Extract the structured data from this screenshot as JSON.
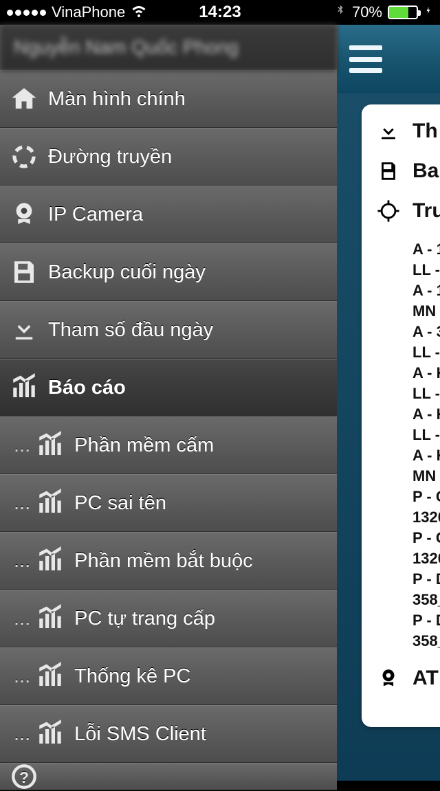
{
  "status": {
    "carrier": "VinaPhone",
    "time": "14:23",
    "battery_pct": "70%"
  },
  "drawer": {
    "header_name": "Nguyễn Nam Quốc Phong",
    "items": [
      {
        "id": "home",
        "label": "Màn hình chính",
        "icon": "home-icon"
      },
      {
        "id": "line",
        "label": "Đường truyền",
        "icon": "target-icon"
      },
      {
        "id": "ipcam",
        "label": "IP Camera",
        "icon": "camera-icon"
      },
      {
        "id": "backup",
        "label": "Backup cuối ngày",
        "icon": "save-icon"
      },
      {
        "id": "params",
        "label": "Tham số đầu ngày",
        "icon": "download-icon"
      },
      {
        "id": "report",
        "label": "Báo cáo",
        "icon": "barchart-icon",
        "selected": true
      },
      {
        "id": "sw_ban",
        "label": "Phần mềm cấm",
        "icon": "barchart-icon",
        "sub": true
      },
      {
        "id": "pc_wrong",
        "label": "PC sai tên",
        "icon": "barchart-icon",
        "sub": true
      },
      {
        "id": "sw_req",
        "label": "Phần mềm bắt buộc",
        "icon": "barchart-icon",
        "sub": true
      },
      {
        "id": "pc_self",
        "label": "PC tự trang cấp",
        "icon": "barchart-icon",
        "sub": true
      },
      {
        "id": "pc_stats",
        "label": "Thống kê PC",
        "icon": "barchart-icon",
        "sub": true
      },
      {
        "id": "sms_err",
        "label": "Lỗi SMS Client",
        "icon": "barchart-icon",
        "sub": true
      }
    ],
    "sub_prefix": "..."
  },
  "main": {
    "rows": [
      {
        "icon": "download-icon",
        "label": "Th"
      },
      {
        "icon": "save-icon",
        "label": "Ba"
      },
      {
        "icon": "target-icon",
        "label": "Tru"
      }
    ],
    "sub_lines": [
      "A - 1",
      "LL -",
      "A - 1",
      "MN -",
      "A - 3",
      "LL -",
      "A - K",
      "LL -",
      "A - K",
      "LL -",
      "A - K",
      "MN -",
      "P - C",
      "1320",
      "P - C",
      "1320",
      "P - D",
      "358_",
      "P - D",
      "358_"
    ],
    "atm": {
      "icon": "camera-icon",
      "label": "AT"
    }
  }
}
